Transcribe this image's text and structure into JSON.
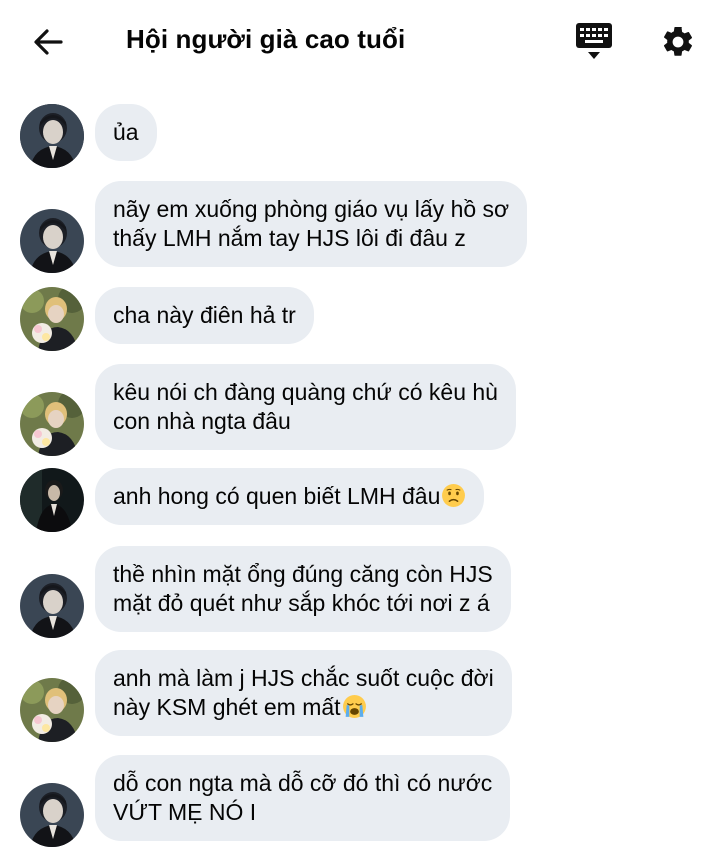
{
  "header": {
    "title": "Hội người già cao tuổi",
    "back_icon": "arrow-left-icon",
    "keyboard_icon": "keyboard-icon",
    "settings_icon": "gear-icon"
  },
  "colors": {
    "bubble": "#e9edf2",
    "text": "#050505",
    "icon": "#111111"
  },
  "messages": [
    {
      "avatar": "avatar-a",
      "lines": [
        "ủa"
      ]
    },
    {
      "avatar": "avatar-a",
      "lines": [
        "nãy em xuống phòng giáo vụ lấy hồ sơ",
        "thấy LMH nắm tay HJS lôi đi đâu z"
      ]
    },
    {
      "avatar": "avatar-b",
      "lines": [
        "cha này điên hả tr"
      ]
    },
    {
      "avatar": "avatar-b",
      "lines": [
        "kêu nói ch đàng quàng chứ có kêu hù",
        "con nhà ngta đâu"
      ]
    },
    {
      "avatar": "avatar-c",
      "lines": [
        "anh hong có quen biết LMH đâu"
      ],
      "emoji": "worried-face-emoji"
    },
    {
      "avatar": "avatar-a",
      "lines": [
        "thề nhìn mặt ổng đúng căng còn HJS",
        "mặt đỏ quét như sắp khóc tới nơi z á"
      ]
    },
    {
      "avatar": "avatar-b",
      "lines": [
        "anh mà làm j HJS chắc suốt cuộc đời",
        "này KSM ghét em mất"
      ],
      "emoji": "crying-face-emoji"
    },
    {
      "avatar": "avatar-a",
      "lines": [
        "dỗ con ngta mà dỗ cỡ đó thì có nước",
        "VỨT MẸ NÓ I"
      ]
    }
  ]
}
